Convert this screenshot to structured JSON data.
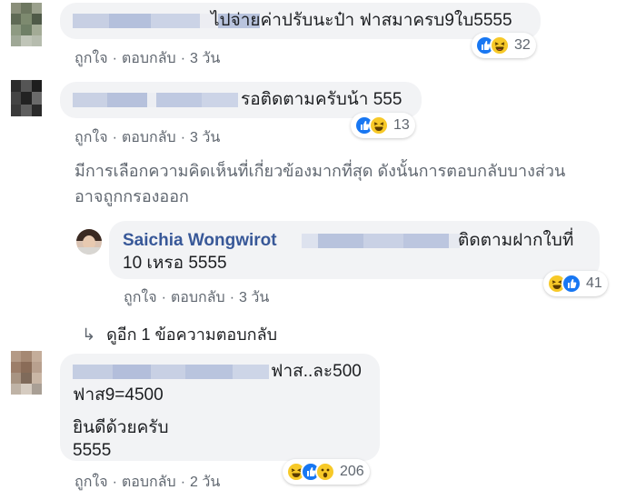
{
  "comments": [
    {
      "text": "ไปจ่ายค่าปรับนะป๋า ฟาสมาครบ9ใบ5555",
      "reaction_count": "32",
      "actions": {
        "like": "ถูกใจ",
        "reply": "ตอบกลับ",
        "time": "3 วัน"
      }
    },
    {
      "text": "รอติดตามครับน้า 555",
      "reaction_count": "13",
      "actions": {
        "like": "ถูกใจ",
        "reply": "ตอบกลับ",
        "time": "3 วัน"
      }
    }
  ],
  "filter_notice": {
    "line1": "มีการเลือกความคิดเห็นที่เกี่ยวข้องมากที่สุด ดังนั้นการตอบกลับบางส่วน",
    "line2": "อาจถูกกรองออก"
  },
  "reply": {
    "author": "Saichia Wongwirot",
    "text_line1": "ติดตามฝากใบที่",
    "text_line2": "10 เหรอ 5555",
    "reaction_count": "41",
    "actions": {
      "like": "ถูกใจ",
      "reply": "ตอบกลับ",
      "time": "3 วัน"
    }
  },
  "more_replies": {
    "arrow": "↳",
    "label": "ดูอีก 1 ข้อความตอบกลับ"
  },
  "last_comment": {
    "text_line1": "ฟาส..ละ500",
    "text_line2": "ฟาส9=4500",
    "text_line3": "ยินดีด้วยครับ",
    "text_line4": "5555",
    "reaction_count": "206",
    "actions": {
      "like": "ถูกใจ",
      "reply": "ตอบกลับ",
      "time": "2 วัน"
    }
  },
  "colors": {
    "bubble": "#f2f3f5",
    "link": "#385898",
    "secondary_text": "#606770",
    "like_blue": "#1877f2",
    "emoji_yellow": "#f7c928"
  }
}
